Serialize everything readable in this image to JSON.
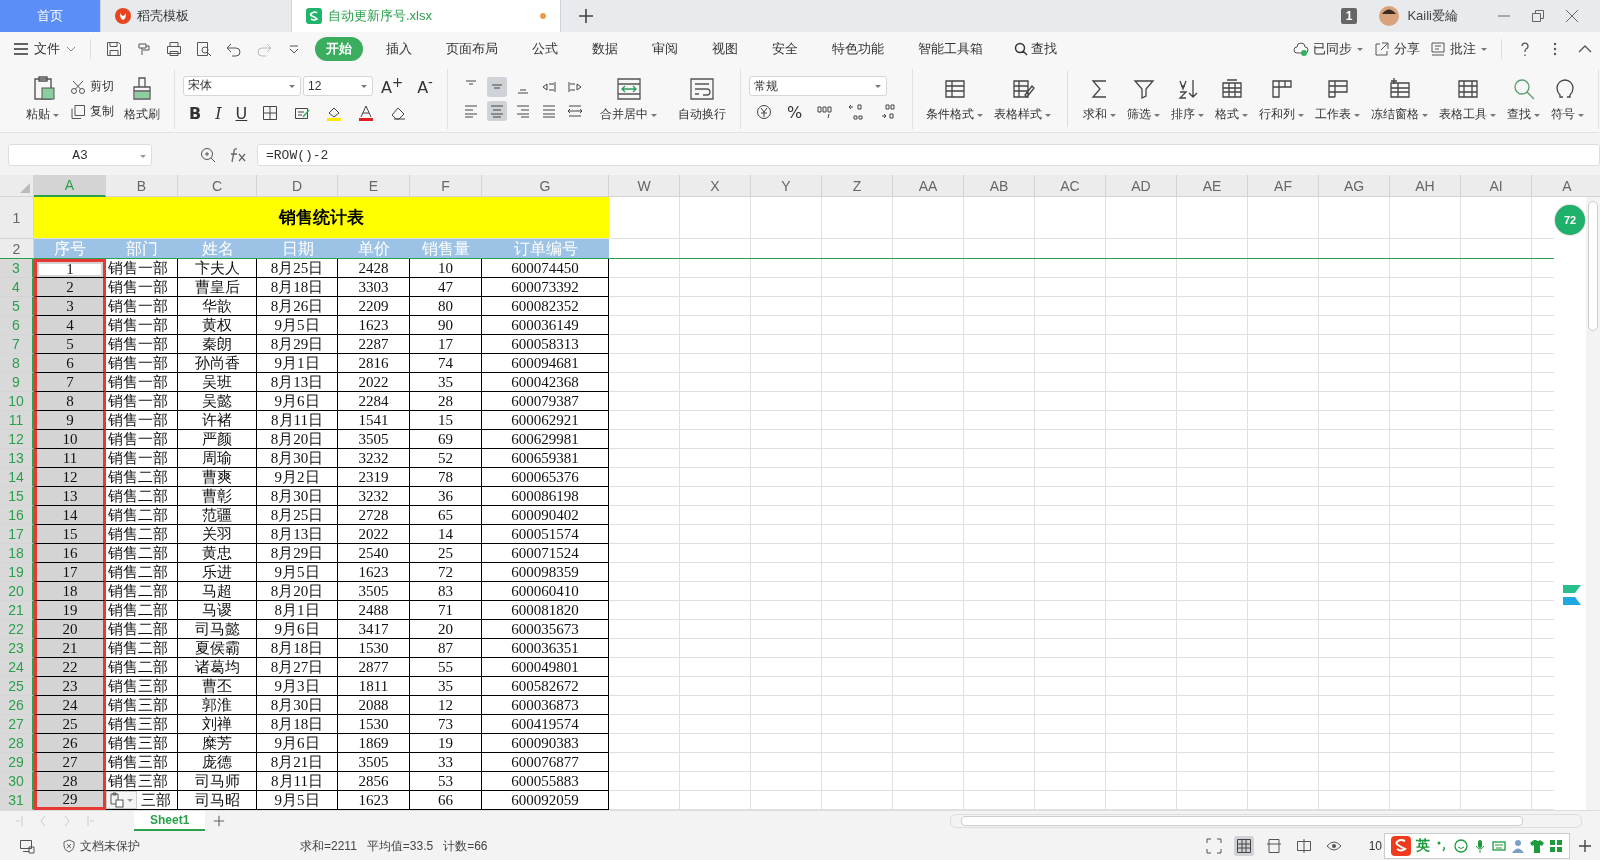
{
  "tabs": [
    {
      "label": "首页",
      "kind": "home",
      "selected": false,
      "modified": false
    },
    {
      "label": "稻壳模板",
      "kind": "app",
      "selected": false,
      "modified": false
    },
    {
      "label": "自动更新序号.xlsx",
      "kind": "file",
      "selected": true,
      "modified": true
    }
  ],
  "title_bar": {
    "window_count": "1",
    "user": "Kaili爱綸"
  },
  "menu": {
    "file": "文件",
    "items": [
      {
        "label": "开始",
        "selected": true
      },
      {
        "label": "插入",
        "selected": false
      },
      {
        "label": "页面布局",
        "selected": false
      },
      {
        "label": "公式",
        "selected": false
      },
      {
        "label": "数据",
        "selected": false
      },
      {
        "label": "审阅",
        "selected": false
      },
      {
        "label": "视图",
        "selected": false
      },
      {
        "label": "安全",
        "selected": false
      },
      {
        "label": "特色功能",
        "selected": false
      },
      {
        "label": "智能工具箱",
        "selected": false
      }
    ],
    "search": "查找",
    "right": [
      "已同步",
      "分享",
      "批注"
    ]
  },
  "ribbon": {
    "paste": "粘贴",
    "cut": "剪切",
    "copy": "复制",
    "painter": "格式刷",
    "font_name": "宋体",
    "font_size": "12",
    "grow": "A$^{+}$",
    "shrink": "A$^{-}$",
    "bold": "B",
    "italic": "I",
    "underline": "U",
    "merge": "合并居中",
    "wrap": "自动换行",
    "number_format": "常规",
    "percent": "%",
    "tools": [
      "条件格式",
      "表格样式",
      "求和",
      "筛选",
      "排序",
      "格式",
      "行和列",
      "工作表",
      "冻结窗格",
      "表格工具",
      "查找",
      "符号"
    ]
  },
  "formula_bar": {
    "name_box": "A3",
    "formula": "=ROW()-2"
  },
  "columns": [
    {
      "label": "A",
      "selected": true
    },
    {
      "label": "B",
      "selected": false
    },
    {
      "label": "C",
      "selected": false
    },
    {
      "label": "D",
      "selected": false
    },
    {
      "label": "E",
      "selected": false
    },
    {
      "label": "F",
      "selected": false
    },
    {
      "label": "G",
      "selected": false
    },
    {
      "label": "W",
      "selected": false
    },
    {
      "label": "X",
      "selected": false
    },
    {
      "label": "Y",
      "selected": false
    },
    {
      "label": "Z",
      "selected": false
    },
    {
      "label": "AA",
      "selected": false
    },
    {
      "label": "AB",
      "selected": false
    },
    {
      "label": "AC",
      "selected": false
    },
    {
      "label": "AD",
      "selected": false
    },
    {
      "label": "AE",
      "selected": false
    },
    {
      "label": "AF",
      "selected": false
    },
    {
      "label": "AG",
      "selected": false
    },
    {
      "label": "AH",
      "selected": false
    },
    {
      "label": "AI",
      "selected": false
    },
    {
      "label": "A",
      "selected": false
    }
  ],
  "title_row": {
    "num": "1",
    "text": "销售统计表"
  },
  "header_row": {
    "num": "2",
    "cells": [
      "序号",
      "部门",
      "姓名",
      "日期",
      "单价",
      "销售量",
      "订单编号"
    ]
  },
  "rows": [
    {
      "num": "3",
      "selected": true,
      "active": true,
      "paste_options": false,
      "cells": [
        "1",
        "销售一部",
        "卞夫人",
        "8月25日",
        "2428",
        "10",
        "600074450"
      ]
    },
    {
      "num": "4",
      "selected": true,
      "active": false,
      "paste_options": false,
      "cells": [
        "2",
        "销售一部",
        "曹皇后",
        "8月18日",
        "3303",
        "47",
        "600073392"
      ]
    },
    {
      "num": "5",
      "selected": true,
      "active": false,
      "paste_options": false,
      "cells": [
        "3",
        "销售一部",
        "华歆",
        "8月26日",
        "2209",
        "80",
        "600082352"
      ]
    },
    {
      "num": "6",
      "selected": true,
      "active": false,
      "paste_options": false,
      "cells": [
        "4",
        "销售一部",
        "黄权",
        "9月5日",
        "1623",
        "90",
        "600036149"
      ]
    },
    {
      "num": "7",
      "selected": true,
      "active": false,
      "paste_options": false,
      "cells": [
        "5",
        "销售一部",
        "秦朗",
        "8月29日",
        "2287",
        "17",
        "600058313"
      ]
    },
    {
      "num": "8",
      "selected": true,
      "active": false,
      "paste_options": false,
      "cells": [
        "6",
        "销售一部",
        "孙尚香",
        "9月1日",
        "2816",
        "74",
        "600094681"
      ]
    },
    {
      "num": "9",
      "selected": true,
      "active": false,
      "paste_options": false,
      "cells": [
        "7",
        "销售一部",
        "吴班",
        "8月13日",
        "2022",
        "35",
        "600042368"
      ]
    },
    {
      "num": "10",
      "selected": true,
      "active": false,
      "paste_options": false,
      "cells": [
        "8",
        "销售一部",
        "吴懿",
        "9月6日",
        "2284",
        "28",
        "600079387"
      ]
    },
    {
      "num": "11",
      "selected": true,
      "active": false,
      "paste_options": false,
      "cells": [
        "9",
        "销售一部",
        "许褚",
        "8月11日",
        "1541",
        "15",
        "600062921"
      ]
    },
    {
      "num": "12",
      "selected": true,
      "active": false,
      "paste_options": false,
      "cells": [
        "10",
        "销售一部",
        "严颜",
        "8月20日",
        "3505",
        "69",
        "600629981"
      ]
    },
    {
      "num": "13",
      "selected": true,
      "active": false,
      "paste_options": false,
      "cells": [
        "11",
        "销售一部",
        "周瑜",
        "8月30日",
        "3232",
        "52",
        "600659381"
      ]
    },
    {
      "num": "14",
      "selected": true,
      "active": false,
      "paste_options": false,
      "cells": [
        "12",
        "销售二部",
        "曹爽",
        "9月2日",
        "2319",
        "78",
        "600065376"
      ]
    },
    {
      "num": "15",
      "selected": true,
      "active": false,
      "paste_options": false,
      "cells": [
        "13",
        "销售二部",
        "曹彰",
        "8月30日",
        "3232",
        "36",
        "600086198"
      ]
    },
    {
      "num": "16",
      "selected": true,
      "active": false,
      "paste_options": false,
      "cells": [
        "14",
        "销售二部",
        "范疆",
        "8月25日",
        "2728",
        "65",
        "600090402"
      ]
    },
    {
      "num": "17",
      "selected": true,
      "active": false,
      "paste_options": false,
      "cells": [
        "15",
        "销售二部",
        "关羽",
        "8月13日",
        "2022",
        "14",
        "600051574"
      ]
    },
    {
      "num": "18",
      "selected": true,
      "active": false,
      "paste_options": false,
      "cells": [
        "16",
        "销售二部",
        "黄忠",
        "8月29日",
        "2540",
        "25",
        "600071524"
      ]
    },
    {
      "num": "19",
      "selected": true,
      "active": false,
      "paste_options": false,
      "cells": [
        "17",
        "销售二部",
        "乐进",
        "9月5日",
        "1623",
        "72",
        "600098359"
      ]
    },
    {
      "num": "20",
      "selected": true,
      "active": false,
      "paste_options": false,
      "cells": [
        "18",
        "销售二部",
        "马超",
        "8月20日",
        "3505",
        "83",
        "600060410"
      ]
    },
    {
      "num": "21",
      "selected": true,
      "active": false,
      "paste_options": false,
      "cells": [
        "19",
        "销售二部",
        "马谡",
        "8月1日",
        "2488",
        "71",
        "600081820"
      ]
    },
    {
      "num": "22",
      "selected": true,
      "active": false,
      "paste_options": false,
      "cells": [
        "20",
        "销售二部",
        "司马懿",
        "9月6日",
        "3417",
        "20",
        "600035673"
      ]
    },
    {
      "num": "23",
      "selected": true,
      "active": false,
      "paste_options": false,
      "cells": [
        "21",
        "销售二部",
        "夏侯霸",
        "8月18日",
        "1530",
        "87",
        "600036351"
      ]
    },
    {
      "num": "24",
      "selected": true,
      "active": false,
      "paste_options": false,
      "cells": [
        "22",
        "销售二部",
        "诸葛均",
        "8月27日",
        "2877",
        "55",
        "600049801"
      ]
    },
    {
      "num": "25",
      "selected": true,
      "active": false,
      "paste_options": false,
      "cells": [
        "23",
        "销售三部",
        "曹丕",
        "9月3日",
        "1811",
        "35",
        "600582672"
      ]
    },
    {
      "num": "26",
      "selected": true,
      "active": false,
      "paste_options": false,
      "cells": [
        "24",
        "销售三部",
        "郭淮",
        "8月30日",
        "2088",
        "12",
        "600036873"
      ]
    },
    {
      "num": "27",
      "selected": true,
      "active": false,
      "paste_options": false,
      "cells": [
        "25",
        "销售三部",
        "刘禅",
        "8月18日",
        "1530",
        "73",
        "600419574"
      ]
    },
    {
      "num": "28",
      "selected": true,
      "active": false,
      "paste_options": false,
      "cells": [
        "26",
        "销售三部",
        "糜芳",
        "9月6日",
        "1869",
        "19",
        "600090383"
      ]
    },
    {
      "num": "29",
      "selected": true,
      "active": false,
      "paste_options": false,
      "cells": [
        "27",
        "销售三部",
        "庞德",
        "8月21日",
        "3505",
        "33",
        "600076877"
      ]
    },
    {
      "num": "30",
      "selected": true,
      "active": false,
      "paste_options": false,
      "cells": [
        "28",
        "销售三部",
        "司马师",
        "8月11日",
        "2856",
        "53",
        "600055883"
      ]
    },
    {
      "num": "31",
      "selected": true,
      "active": false,
      "paste_options": true,
      "cells": [
        "29",
        "三部",
        "司马昭",
        "9月5日",
        "1623",
        "66",
        "600092059"
      ]
    }
  ],
  "side_badge": "72",
  "sheet_tabs": [
    {
      "label": "Sheet1",
      "selected": true
    }
  ],
  "status_bar": {
    "protection": "文档未保护",
    "sum": "求和=2211",
    "average": "平均值=33.5",
    "count": "计数=66",
    "zoom": "10",
    "ime": "英"
  }
}
